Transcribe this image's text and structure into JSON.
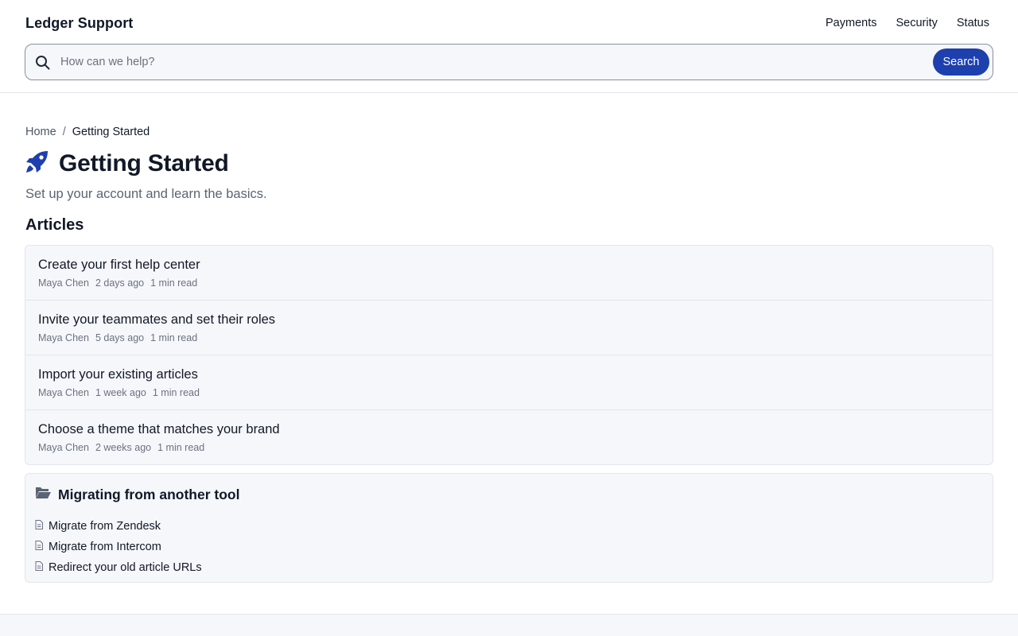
{
  "brand": "Ledger Support",
  "nav": [
    "Payments",
    "Security",
    "Status"
  ],
  "search": {
    "placeholder": "How can we help?",
    "button": "Search"
  },
  "breadcrumb": {
    "home": "Home",
    "separator": "/",
    "current": "Getting Started"
  },
  "page": {
    "icon": "rocket-icon",
    "title": "Getting Started",
    "subtitle": "Set up your account and learn the basics."
  },
  "articles": {
    "heading": "Articles",
    "items": [
      {
        "title": "Create your first help center",
        "author": "Maya Chen",
        "date": "2 days ago",
        "read": "1 min read"
      },
      {
        "title": "Invite your teammates and set their roles",
        "author": "Maya Chen",
        "date": "5 days ago",
        "read": "1 min read"
      },
      {
        "title": "Import your existing articles",
        "author": "Maya Chen",
        "date": "1 week ago",
        "read": "1 min read"
      },
      {
        "title": "Choose a theme that matches your brand",
        "author": "Maya Chen",
        "date": "2 weeks ago",
        "read": "1 min read"
      }
    ]
  },
  "section": {
    "icon": "folder-open-icon",
    "title": "Migrating from another tool",
    "links": [
      "Migrate from Zendesk",
      "Migrate from Intercom",
      "Redirect your old article URLs"
    ],
    "link_icon": "document-icon"
  },
  "colors": {
    "accent": "#1e3fae",
    "surface": "#f5f7fa",
    "border": "#e3e6eb",
    "muted": "#6b7280"
  }
}
